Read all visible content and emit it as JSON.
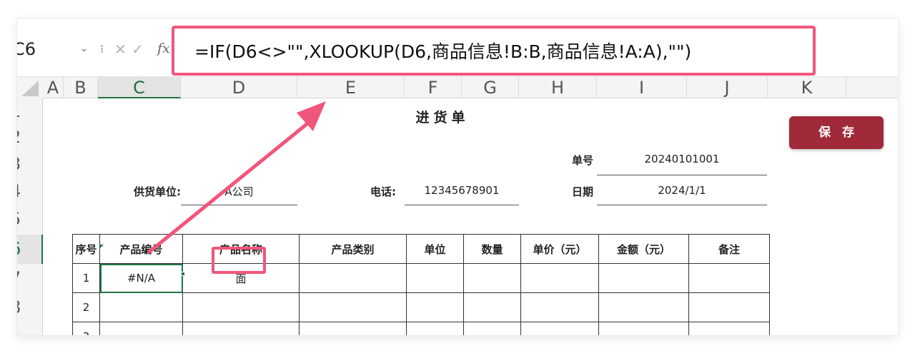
{
  "formula_bar": {
    "cell_ref": "C6",
    "chevron": "⌄",
    "dots": "⁝",
    "cancel": "✕",
    "confirm": "✓",
    "fx": "fx",
    "formula": "=IF(D6<>\"\",XLOOKUP(D6,商品信息!B:B,商品信息!A:A),\"\")"
  },
  "columns": [
    "A",
    "B",
    "C",
    "D",
    "E",
    "F",
    "G",
    "H",
    "I",
    "J",
    "K"
  ],
  "selected_column": "C",
  "rows": [
    "1",
    "2",
    "3",
    "4",
    "5",
    "6",
    "7",
    "8"
  ],
  "selected_row": "6",
  "sheet": {
    "title": "进货单",
    "order_no_label": "单号",
    "order_no": "20240101001",
    "supplier_label": "供货单位:",
    "supplier": "A公司",
    "phone_label": "电话:",
    "phone": "12345678901",
    "date_label": "日期",
    "date": "2024/1/1",
    "table": {
      "headers": [
        "序号",
        "产品编号",
        "产品名称",
        "产品类别",
        "单位",
        "数量",
        "单价（元）",
        "金额（元）",
        "备注"
      ],
      "rows": [
        [
          "1",
          "#N/A",
          "面",
          "",
          "",
          "",
          "",
          "",
          ""
        ],
        [
          "2",
          "",
          "",
          "",
          "",
          "",
          "",
          "",
          ""
        ],
        [
          "3",
          "",
          "",
          "",
          "",
          "",
          "",
          "",
          ""
        ]
      ]
    }
  },
  "save_button": {
    "label": "保存"
  },
  "colors": {
    "save": "#a12a3a",
    "highlight": "#f2557b",
    "selection": "#217346"
  }
}
